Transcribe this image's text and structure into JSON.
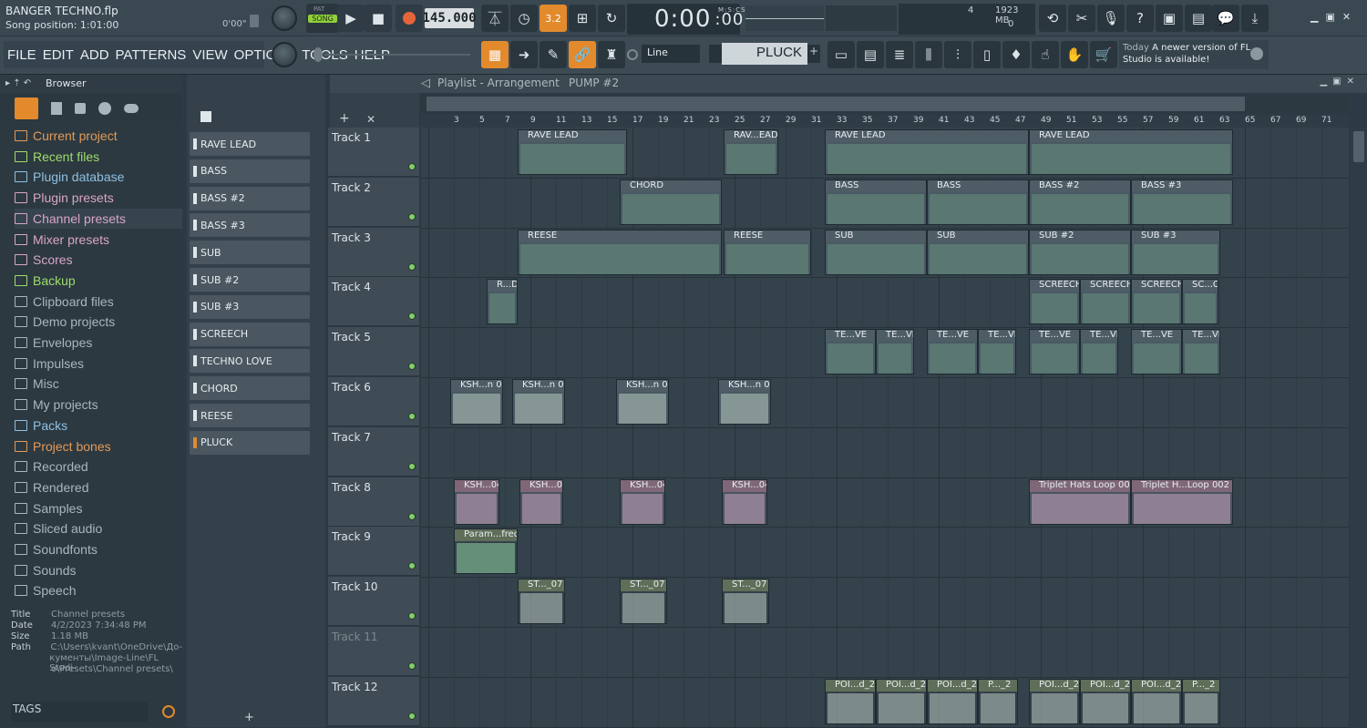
{
  "project": {
    "title": "BANGER TECHNO.flp",
    "song_position": "Song position: 1:01:00",
    "song_time": "0'00\""
  },
  "transport": {
    "pat_label": "PAT",
    "song_label": "SONG",
    "tempo": "145.000",
    "time_display": "0:00",
    "time_ms": ":00",
    "time_unit": "M:S:CS",
    "step_label": "3.2"
  },
  "menu": [
    "FILE",
    "EDIT",
    "ADD",
    "PATTERNS",
    "VIEW",
    "OPTIONS",
    "TOOLS",
    "HELP"
  ],
  "cpu": {
    "value": "4",
    "memory": "1923 MB",
    "voices": "0"
  },
  "snap": {
    "mode": "Line",
    "channel": "PLUCK"
  },
  "notification": {
    "when": "Today",
    "message": "A newer version of FL Studio is available!"
  },
  "browser": {
    "title": "Browser",
    "items": [
      {
        "label": "Current project",
        "color": "#e49a57"
      },
      {
        "label": "Recent files",
        "color": "#9fdc6a"
      },
      {
        "label": "Plugin database",
        "color": "#8fc0e3"
      },
      {
        "label": "Plugin presets",
        "color": "#d9a5c7"
      },
      {
        "label": "Channel presets",
        "color": "#d9a5c7"
      },
      {
        "label": "Mixer presets",
        "color": "#d9a5c7"
      },
      {
        "label": "Scores",
        "color": "#d9a5c7"
      },
      {
        "label": "Backup",
        "color": "#9fdc6a"
      },
      {
        "label": "Clipboard files",
        "color": "#aab6bd"
      },
      {
        "label": "Demo projects",
        "color": "#aab6bd"
      },
      {
        "label": "Envelopes",
        "color": "#aab6bd"
      },
      {
        "label": "Impulses",
        "color": "#aab6bd"
      },
      {
        "label": "Misc",
        "color": "#aab6bd"
      },
      {
        "label": "My projects",
        "color": "#aab6bd"
      },
      {
        "label": "Packs",
        "color": "#8fc0e3"
      },
      {
        "label": "Project bones",
        "color": "#e49a57"
      },
      {
        "label": "Recorded",
        "color": "#aab6bd"
      },
      {
        "label": "Rendered",
        "color": "#aab6bd"
      },
      {
        "label": "Samples",
        "color": "#aab6bd"
      },
      {
        "label": "Sliced audio",
        "color": "#aab6bd"
      },
      {
        "label": "Soundfonts",
        "color": "#aab6bd"
      },
      {
        "label": "Sounds",
        "color": "#aab6bd"
      },
      {
        "label": "Speech",
        "color": "#aab6bd"
      }
    ],
    "info": [
      {
        "key": "Title",
        "value": "Channel presets"
      },
      {
        "key": "Date",
        "value": "4/2/2023 7:34:48 PM"
      },
      {
        "key": "Size",
        "value": "1.18 MB"
      },
      {
        "key": "Path",
        "value": "C:\\Users\\kvant\\OneDrive\\До-"
      },
      {
        "key": "",
        "value": "кументы\\Image-Line\\FL Studi-"
      },
      {
        "key": "",
        "value": "o\\Presets\\Channel presets\\"
      }
    ],
    "tags_label": "TAGS"
  },
  "patterns": [
    "RAVE LEAD",
    "BASS",
    "BASS #2",
    "BASS #3",
    "SUB",
    "SUB #2",
    "SUB #3",
    "SCREECH",
    "TECHNO LOVE",
    "CHORD",
    "REESE",
    "PLUCK"
  ],
  "playlist": {
    "title": "Playlist - Arrangement",
    "pattern": "PUMP #2"
  },
  "ruler": [
    "3",
    "5",
    "7",
    "9",
    "11",
    "13",
    "15",
    "17",
    "19",
    "21",
    "23",
    "25",
    "27",
    "29",
    "31",
    "33",
    "35",
    "37",
    "39",
    "41",
    "43",
    "45",
    "47",
    "49",
    "51",
    "53",
    "55",
    "57",
    "59",
    "61",
    "63",
    "65",
    "67",
    "69",
    "71"
  ],
  "tracks": [
    "Track 1",
    "Track 2",
    "Track 3",
    "Track 4",
    "Track 5",
    "Track 6",
    "Track 7",
    "Track 8",
    "Track 9",
    "Track 10",
    "Track 11",
    "Track 12"
  ],
  "clips": [
    {
      "track": 0,
      "label": "RAVE LEAD"
    },
    {
      "track": 0,
      "label": "RAV...EAD"
    },
    {
      "track": 0,
      "label": "RAVE LEAD"
    },
    {
      "track": 0,
      "label": "RAVE LEAD"
    },
    {
      "track": 1,
      "label": "CHORD"
    },
    {
      "track": 1,
      "label": "BASS"
    },
    {
      "track": 1,
      "label": "BASS"
    },
    {
      "track": 1,
      "label": "BASS #2"
    },
    {
      "track": 1,
      "label": "BASS #3"
    },
    {
      "track": 2,
      "label": "REESE"
    },
    {
      "track": 2,
      "label": "REESE"
    },
    {
      "track": 2,
      "label": "SUB"
    },
    {
      "track": 2,
      "label": "SUB"
    },
    {
      "track": 2,
      "label": "SUB #2"
    },
    {
      "track": 2,
      "label": "SUB #3"
    },
    {
      "track": 3,
      "label": "R...D"
    },
    {
      "track": 3,
      "label": "SCREECH"
    },
    {
      "track": 3,
      "label": "SCREECH"
    },
    {
      "track": 3,
      "label": "SCREECH"
    },
    {
      "track": 3,
      "label": "SC...CH"
    },
    {
      "track": 4,
      "label": "TE...VE"
    },
    {
      "track": 4,
      "label": "TE...VE"
    },
    {
      "track": 4,
      "label": "TE...VE"
    },
    {
      "track": 4,
      "label": "TE...VE"
    },
    {
      "track": 4,
      "label": "TE...VE"
    },
    {
      "track": 4,
      "label": "TE...VE"
    },
    {
      "track": 4,
      "label": "TE...VE"
    },
    {
      "track": 4,
      "label": "TE...VE"
    },
    {
      "track": 5,
      "label": "KSH...n 01"
    },
    {
      "track": 5,
      "label": "KSH...n 01"
    },
    {
      "track": 5,
      "label": "KSH...n 01"
    },
    {
      "track": 5,
      "label": "KSH...n 01"
    },
    {
      "track": 7,
      "label": "KSH...04"
    },
    {
      "track": 7,
      "label": "KSH...04"
    },
    {
      "track": 7,
      "label": "KSH...04"
    },
    {
      "track": 7,
      "label": "KSH...04"
    },
    {
      "track": 7,
      "label": "Triplet Hats Loop 002"
    },
    {
      "track": 7,
      "label": "Triplet H...Loop 002"
    },
    {
      "track": 8,
      "label": "Param...freq"
    },
    {
      "track": 9,
      "label": "ST..._07"
    },
    {
      "track": 9,
      "label": "ST..._07"
    },
    {
      "track": 9,
      "label": "ST..._07"
    },
    {
      "track": 11,
      "label": "POI...d_2"
    },
    {
      "track": 11,
      "label": "POI...d_2"
    },
    {
      "track": 11,
      "label": "POI...d_2"
    },
    {
      "track": 11,
      "label": "P..._2"
    },
    {
      "track": 11,
      "label": "POI...d_2"
    },
    {
      "track": 11,
      "label": "POI...d_2"
    },
    {
      "track": 11,
      "label": "POI...d_2"
    },
    {
      "track": 11,
      "label": "P..._2"
    }
  ]
}
